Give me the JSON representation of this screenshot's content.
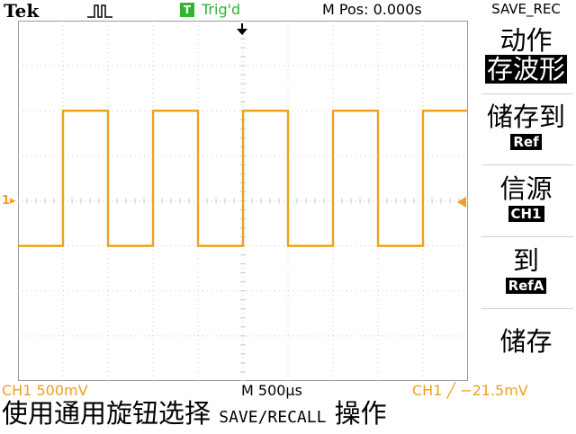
{
  "header": {
    "brand": "Tek",
    "trigger_badge": "T",
    "trigger_status": "Trig'd",
    "position": "M Pos: 0.000s"
  },
  "menu": {
    "title": "SAVE_REC",
    "items": [
      {
        "label": "动作",
        "value": "存波形",
        "value_style": "inverse-large"
      },
      {
        "label": "储存到",
        "value": "Ref",
        "value_style": "inverse-small"
      },
      {
        "label": "信源",
        "value": "CH1",
        "value_style": "inverse-small"
      },
      {
        "label": "到",
        "value": "RefA",
        "value_style": "inverse-small"
      },
      {
        "label": "储存",
        "value": "",
        "value_style": "none"
      }
    ]
  },
  "status": {
    "channel": "CH1  500mV",
    "timebase": "M 500µs",
    "trigger": "CH1 ╱ −21.5mV"
  },
  "footer": {
    "prefix": "使用通用旋钮选择",
    "keyword": "SAVE/RECALL",
    "suffix": "操作"
  },
  "markers": {
    "ch1_left": "1▸"
  },
  "watermark": {
    "text": "",
    "url": ""
  },
  "waveform": {
    "color": "#f0a020",
    "grid_color": "#c8c8c8",
    "high_level_div": 2,
    "low_level_div": -1,
    "center_div": 0,
    "periods_visible": 5,
    "duty_cycle": 0.5
  }
}
